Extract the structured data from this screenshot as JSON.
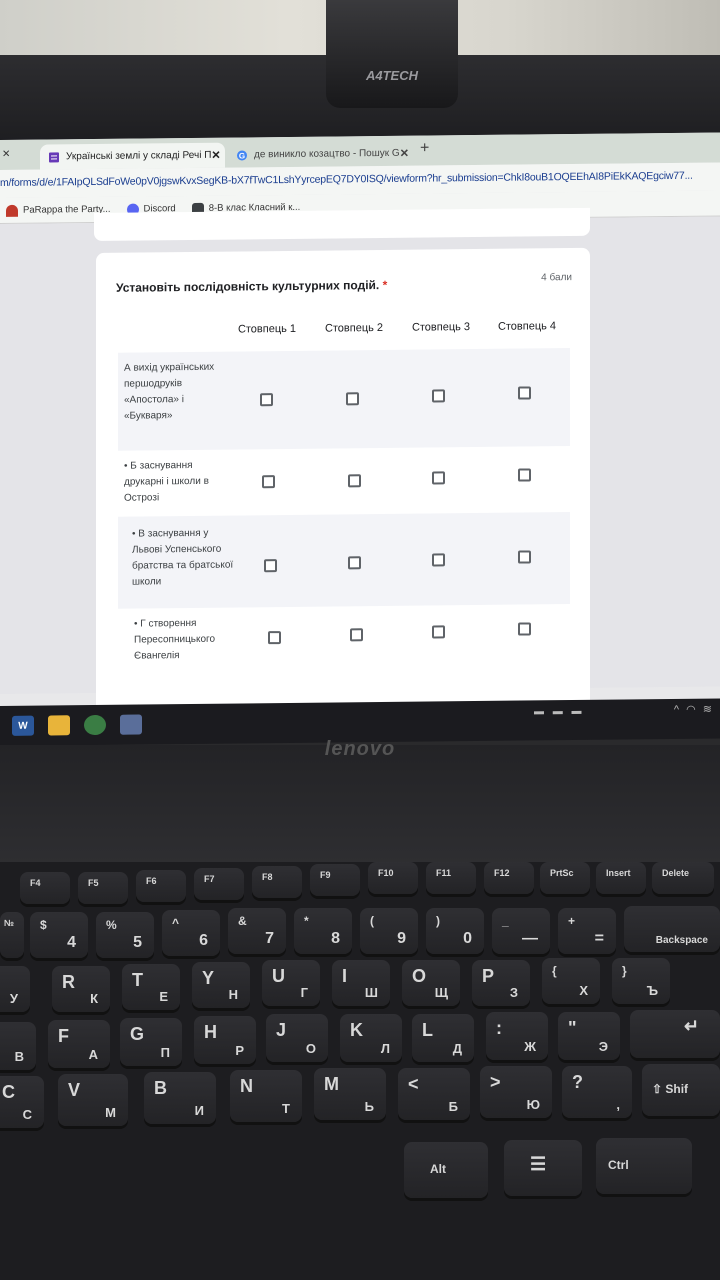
{
  "webcam": {
    "brand": "A4TECH"
  },
  "browser": {
    "tab_unknown_close": "✕",
    "tabs": [
      {
        "title": "Українські землі у складі Речі П",
        "close": "✕",
        "icon": "google-forms-icon"
      },
      {
        "title": "де виникло козацтво - Пошук G",
        "close": "✕",
        "icon": "google-icon"
      }
    ],
    "new_tab": "+",
    "url": "m/forms/d/e/1FAIpQLSdFoWe0pV0jgswKvxSegKB-bX7fTwC1LshYyrcepEQ7DY0ISQ/viewform?hr_submission=ChkI8ouB1OQEEhAI8PiEkKAQEgciw77...",
    "bookmarks": [
      {
        "label": "PaRappa the Party...",
        "icon": "parappa-icon",
        "color": "#c0392b"
      },
      {
        "label": "Discord",
        "icon": "discord-icon",
        "color": "#5865f2"
      },
      {
        "label": "8-В клас Класний к...",
        "icon": "classroom-icon",
        "color": "#3c4043"
      }
    ]
  },
  "form": {
    "question": "Установіть послідовність культурних подій.",
    "required_mark": "*",
    "points": "4 бали",
    "columns": [
      "Стовпець 1",
      "Стовпець 2",
      "Стовпець 3",
      "Стовпець 4"
    ],
    "rows": [
      {
        "label": "А вихід українських першодруків «Апостола» і «Букваря»"
      },
      {
        "label": "• Б заснування друкарні і школи в Острозі"
      },
      {
        "label": "• В заснування у Львові Успенського братства та братської школи"
      },
      {
        "label": "• Г створення Пересопницького Євангелія"
      }
    ]
  },
  "taskbar": {
    "apps": [
      {
        "icon": "word-icon",
        "label": "W",
        "color": "#2b579a"
      },
      {
        "icon": "file-explorer-icon",
        "label": "",
        "color": "#e8b43a"
      },
      {
        "icon": "chrome-icon",
        "label": "",
        "color": "#3a7d44"
      },
      {
        "icon": "paint-icon",
        "label": "",
        "color": "#5a6e9a"
      }
    ],
    "tray": "^ ◠ ≋",
    "tray_left": "▬ ▬ ▬"
  },
  "laptop": {
    "brand": "lenovo"
  },
  "keyboard": {
    "function_keys": [
      "F4",
      "F5",
      "F6",
      "F7",
      "F8",
      "F9",
      "F10",
      "F11",
      "F12",
      "PrtSc",
      "Insert",
      "Delete"
    ],
    "number_row": [
      "№",
      "$",
      "%",
      "^",
      "&",
      "*",
      "(",
      ")",
      "_",
      "+"
    ],
    "number_row_digits": [
      "4",
      "5",
      "6",
      "7",
      "8",
      "9",
      "0",
      "—",
      "="
    ],
    "backspace": "Backspace",
    "row_q": [
      {
        "lat": "",
        "cyr": "У"
      },
      {
        "lat": "R",
        "cyr": "К"
      },
      {
        "lat": "T",
        "cyr": "Е"
      },
      {
        "lat": "Y",
        "cyr": "Н"
      },
      {
        "lat": "U",
        "cyr": "Г"
      },
      {
        "lat": "I",
        "cyr": "Ш"
      },
      {
        "lat": "O",
        "cyr": "Щ"
      },
      {
        "lat": "P",
        "cyr": "З"
      },
      {
        "lat": "{",
        "cyr": "Х"
      },
      {
        "lat": "}",
        "cyr": "Ъ"
      }
    ],
    "row_a": [
      {
        "lat": "",
        "cyr": "В"
      },
      {
        "lat": "F",
        "cyr": "А"
      },
      {
        "lat": "G",
        "cyr": "П"
      },
      {
        "lat": "H",
        "cyr": "Р"
      },
      {
        "lat": "J",
        "cyr": "О"
      },
      {
        "lat": "K",
        "cyr": "Л"
      },
      {
        "lat": "L",
        "cyr": "Д"
      },
      {
        "lat": ":",
        "cyr": "Ж"
      },
      {
        "lat": "\"",
        "cyr": "Э"
      }
    ],
    "row_z": [
      {
        "lat": "C",
        "cyr": "С"
      },
      {
        "lat": "V",
        "cyr": "М"
      },
      {
        "lat": "B",
        "cyr": "И"
      },
      {
        "lat": "N",
        "cyr": "Т"
      },
      {
        "lat": "M",
        "cyr": "Ь"
      },
      {
        "lat": "<",
        "cyr": "Б"
      },
      {
        "lat": ">",
        "cyr": "Ю"
      },
      {
        "lat": "?",
        "cyr": ","
      }
    ],
    "shift": "⇧ Shif",
    "alt": "Alt",
    "menu": "☰",
    "ctrl": "Ctrl"
  }
}
